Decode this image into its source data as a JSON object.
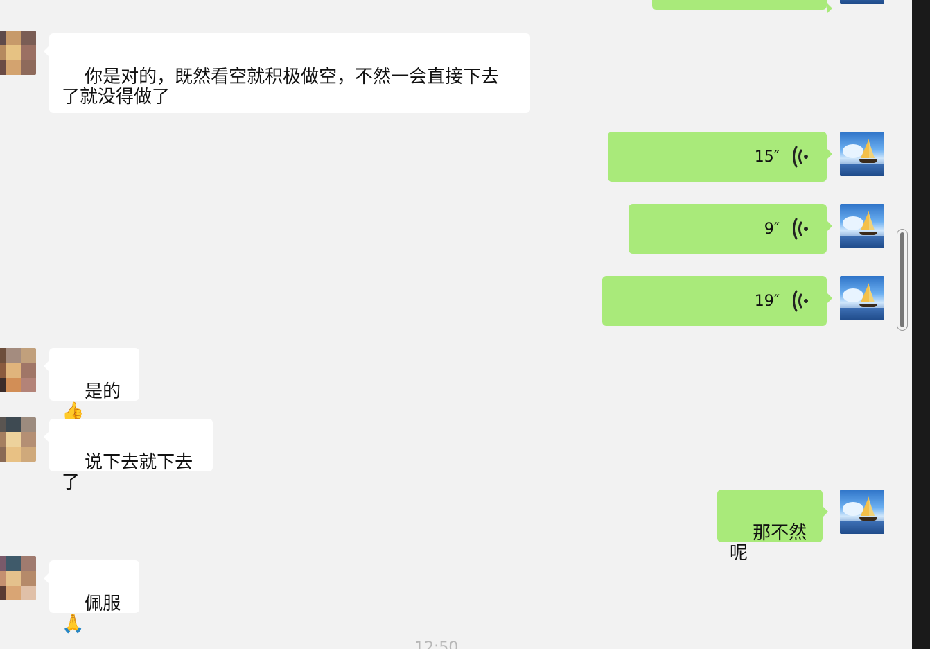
{
  "messages": [
    {
      "side": "in",
      "type": "text",
      "text": "你是对的，既然看空就积极做空，不然一会直接下去\n了就没得做了"
    },
    {
      "side": "out",
      "type": "voice",
      "duration": "15″"
    },
    {
      "side": "out",
      "type": "voice",
      "duration": "9″"
    },
    {
      "side": "out",
      "type": "voice",
      "duration": "19″"
    },
    {
      "side": "in",
      "type": "text",
      "text": "是的👍"
    },
    {
      "side": "in",
      "type": "text",
      "text": "说下去就下去了"
    },
    {
      "side": "out",
      "type": "text",
      "text": "那不然呢"
    },
    {
      "side": "in",
      "type": "text",
      "text": "佩服🙏"
    }
  ],
  "timestamp": "12:50",
  "colors": {
    "background": "#f2f2f2",
    "incoming_bubble": "#ffffff",
    "outgoing_bubble": "#a9ea7a",
    "text": "#111111",
    "timestamp": "#b7b7b7"
  },
  "icons": {
    "voice": "voice-wave-icon",
    "self_avatar": "sailboat-avatar",
    "other_avatar": "pixelated-avatar"
  }
}
